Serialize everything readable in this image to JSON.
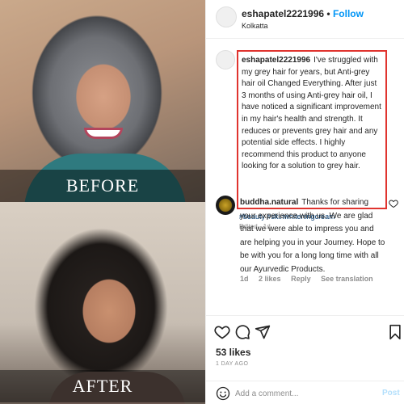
{
  "photos": {
    "before_label": "BEFORE",
    "after_label": "AFTER"
  },
  "post": {
    "username": "eshapatel2221996",
    "separator": "•",
    "follow_label": "Follow",
    "location": "Kolkatta",
    "caption_author": "eshapatel2221996",
    "caption": "I've struggled with my grey hair for years, but Anti-grey hair oil Changed Everything. After just 3 months of using Anti-grey hair oil, I have noticed a significant improvement in my hair's health and strength. It reduces or prevents grey hair and any potential side effects. I highly recommend this product to anyone looking for a solution to grey hair.",
    "hashtags": "#beauty #skinwhiteningcream",
    "edited": "Edited · 1d"
  },
  "reply": {
    "author": "buddha.natural",
    "text": "Thanks for sharing your experience with us. We are glad that we were able to impress you and are helping you in your Journey. Hope to be with you for a long long time with all our Ayurvedic Products.",
    "time": "1d",
    "likes": "2 likes",
    "reply_label": "Reply",
    "translate_label": "See translation"
  },
  "actions": {
    "likes": "53 likes",
    "ago": "1 DAY AGO"
  },
  "comment": {
    "placeholder": "Add a comment...",
    "post_label": "Post"
  },
  "colors": {
    "follow": "#0095f6",
    "highlight_border": "#e0342f",
    "hashtag": "#00376b"
  },
  "icons": [
    "heart-icon",
    "comment-icon",
    "share-icon",
    "bookmark-icon",
    "emoji-icon"
  ]
}
